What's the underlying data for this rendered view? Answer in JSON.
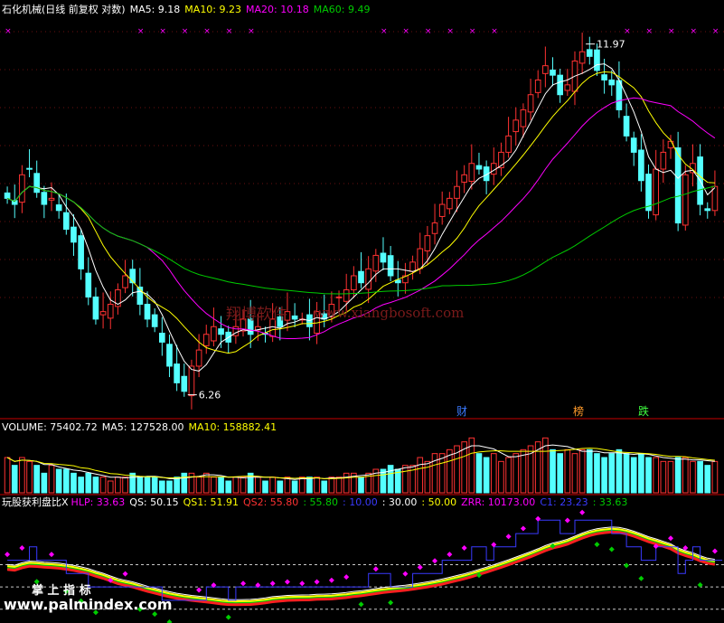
{
  "colors": {
    "up": "#ff3232",
    "down": "#54ffff",
    "white": "#ffffff",
    "yellow": "#ffff00",
    "magenta": "#ff00ff",
    "green": "#00cc00",
    "blue": "#3a3aff",
    "grid": "#c8c8c8",
    "divider": "#c80000"
  },
  "price_header": {
    "title": "石化机械(日线 前复权 对数)",
    "ma5": "MA5: 9.18",
    "ma10": "MA10: 9.23",
    "ma20": "MA20: 10.18",
    "ma60": "MA60: 9.49"
  },
  "volume_header": {
    "label": "VOLUME: 75402.72",
    "ma5": "MA5: 127528.00",
    "ma10": "MA10: 158882.41"
  },
  "indicator_header": {
    "name": "玩股获利盘比X",
    "hlp": "HLP: 33.63",
    "qs": "QS: 50.15",
    "qs1": "QS1: 51.91",
    "qs2": "QS2: 55.80",
    "v1": ": 55.80",
    "v2": ": 10.00",
    "v3": ": 30.00",
    "v4": ": 50.00",
    "zrr": "ZRR: 10173.00",
    "c1": "C1: 23.23",
    "v5": ": 33.63"
  },
  "annotations": {
    "high": "11.97",
    "low": "6.26",
    "event_cai": "财",
    "event_bang": "榜",
    "event_die": "跌"
  },
  "watermark": {
    "cn": "翔博软件",
    "url": "www.xiangbosoft.com",
    "brand": "掌 上 指 标",
    "brand_url": "www.palmindex.com"
  },
  "chart_data": [
    {
      "type": "candlestick",
      "title": "石化机械(日线 前复权 对数)",
      "ylim": [
        6.0,
        12.6
      ],
      "scale": "log",
      "grid": true,
      "high": 11.97,
      "low": 6.26,
      "close": [
        9.0,
        8.9,
        9.4,
        9.5,
        9.1,
        8.9,
        9.0,
        8.8,
        8.5,
        8.3,
        7.9,
        7.5,
        7.2,
        7.3,
        7.4,
        7.6,
        7.8,
        7.7,
        7.4,
        7.2,
        7.1,
        6.9,
        6.6,
        6.4,
        6.3,
        6.6,
        6.8,
        7.0,
        7.1,
        7.0,
        6.9,
        7.1,
        7.2,
        7.0,
        7.1,
        7.0,
        7.2,
        7.1,
        7.3,
        7.2,
        7.2,
        7.1,
        7.3,
        7.2,
        7.4,
        7.5,
        7.6,
        7.8,
        7.7,
        7.9,
        8.1,
        8.0,
        7.8,
        7.7,
        7.8,
        8.0,
        8.2,
        8.4,
        8.6,
        8.9,
        9.0,
        9.2,
        9.4,
        9.6,
        9.5,
        9.3,
        9.6,
        9.8,
        10.1,
        10.4,
        10.6,
        10.9,
        11.2,
        11.5,
        11.3,
        10.9,
        11.1,
        11.6,
        11.8,
        11.7,
        11.4,
        11.2,
        11.1,
        10.6,
        10.1,
        9.8,
        9.3,
        8.8,
        9.5,
        9.8,
        10.0,
        8.6,
        9.4,
        9.6,
        8.9,
        8.8,
        9.2
      ],
      "ma5": 9.18,
      "ma10": 9.23,
      "ma20": 10.18,
      "ma60": 9.49
    },
    {
      "type": "bar",
      "ylabel": "VOLUME",
      "values": [
        9,
        7,
        9,
        8,
        7,
        5,
        7,
        6,
        6,
        5,
        4,
        5,
        4,
        4,
        3,
        4,
        4,
        5,
        4,
        4,
        4,
        3,
        3,
        4,
        5,
        5,
        4,
        5,
        4,
        4,
        3,
        4,
        4,
        5,
        4,
        3,
        4,
        3,
        4,
        3,
        4,
        4,
        4,
        3,
        4,
        4,
        5,
        5,
        4,
        5,
        6,
        6,
        7,
        6,
        7,
        7,
        9,
        8,
        10,
        10,
        11,
        12,
        13,
        14,
        10,
        9,
        10,
        8,
        9,
        10,
        11,
        12,
        13,
        14,
        11,
        10,
        11,
        10,
        11,
        11,
        10,
        9,
        10,
        11,
        10,
        9,
        10,
        9,
        9,
        8,
        8,
        9,
        9,
        8,
        8,
        7,
        8
      ],
      "ma5": 127528.0,
      "ma10": 158882.41,
      "ylim": [
        0,
        15
      ]
    },
    {
      "type": "line",
      "name": "玩股获利盘比X",
      "ylim": [
        0,
        100
      ],
      "reference_lines": [
        10,
        30,
        50
      ],
      "hlp": 33.63,
      "qs": 50.15,
      "qs1": 51.91,
      "qs2": 55.8,
      "zrr": 10173.0,
      "c1": 23.23
    }
  ]
}
